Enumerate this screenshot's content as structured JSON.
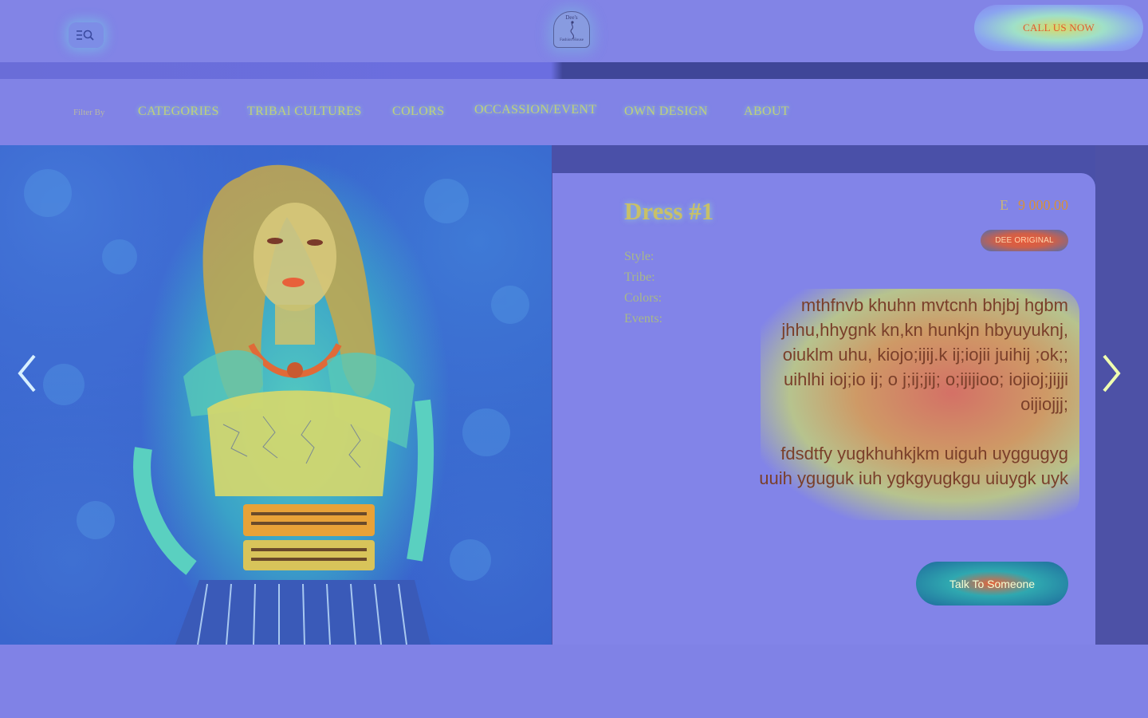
{
  "header": {
    "logo_text": "Dee's",
    "logo_sub": "Fashion House",
    "logo_tag": "",
    "call_label": "CALL US NOW"
  },
  "filter": {
    "label": "Filter By",
    "items": [
      {
        "label": "CATEGORIES"
      },
      {
        "label": "TRIBAl CULTURES"
      },
      {
        "label": "COLORS"
      },
      {
        "label": "OCCASSION/EVENT"
      },
      {
        "label": "OWN DESIGN"
      },
      {
        "label": "ABOUT"
      }
    ]
  },
  "product": {
    "title": "Dress #1",
    "currency": "E",
    "price": "9 000.00",
    "badge": "DEE ORIGINAL",
    "attributes": {
      "style": "Style:",
      "tribe": "Tribe:",
      "colors": "Colors:",
      "events": "Events:"
    },
    "description": [
      "mthfnvb khuhn mvtcnh bhjbj hgbm jhhu,hhygnk kn,kn hunkjn hbyuyuknj, oiuklm uhu, kiojo;ijij.k ij;iojii juihij ;ok;; uihlhi ioj;io ij; o j;ij;jij; o;ijijioo; iojioj;jijji oijiojjj;",
      "fdsdtfy yugkhuhkjkm uiguh uyggugyg uuih yguguk iuh ygkgyugkgu uiuygk uyk"
    ],
    "cta_label": "Talk To Someone"
  },
  "icons": {
    "menu": "menu-search-icon",
    "prev": "chevron-left-icon",
    "next": "chevron-right-icon"
  }
}
